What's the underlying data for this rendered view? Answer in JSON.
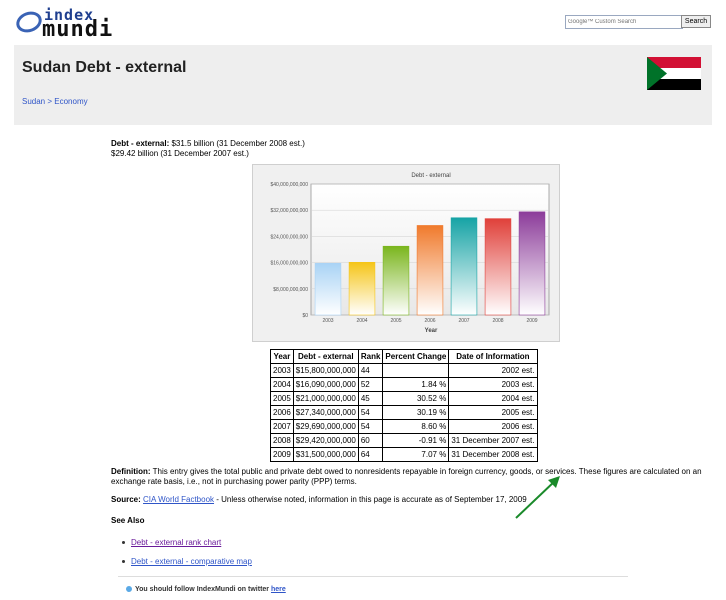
{
  "logo": {
    "line1": "index",
    "line2": "mundi"
  },
  "search": {
    "placeholder": "Google™ Custom Search",
    "button_label": "Search"
  },
  "page": {
    "title": "Sudan Debt - external"
  },
  "breadcrumb": {
    "country": "Sudan",
    "separator": " > ",
    "section": "Economy"
  },
  "facts": {
    "label": "Debt - external:",
    "line1_value": " $31.5 billion (31 December 2008 est.)",
    "line2": "$29.42 billion (31 December 2007 est.)"
  },
  "chart_data": {
    "type": "bar",
    "title": "Debt - external",
    "xlabel": "Year",
    "categories": [
      "2003",
      "2004",
      "2005",
      "2006",
      "2007",
      "2008",
      "2009"
    ],
    "values": [
      15800000000,
      16090000000,
      21000000000,
      27340000000,
      29690000000,
      29420000000,
      31500000000
    ],
    "ylim": [
      0,
      40000000000
    ],
    "yticks": [
      "$0",
      "$8,000,000,000",
      "$16,000,000,000",
      "$24,000,000,000",
      "$32,000,000,000",
      "$40,000,000,000"
    ],
    "colors": [
      "#a9d3f5",
      "#f5c518",
      "#7ab51d",
      "#f07a2c",
      "#16a3a5",
      "#e0403a",
      "#8c3c9a"
    ],
    "grid": true
  },
  "table": {
    "headers": [
      "Year",
      "Debt - external",
      "Rank",
      "Percent Change",
      "Date of Information"
    ],
    "rows": [
      [
        "2003",
        "$15,800,000,000",
        "44",
        "",
        "2002 est."
      ],
      [
        "2004",
        "$16,090,000,000",
        "52",
        "1.84 %",
        "2003 est."
      ],
      [
        "2005",
        "$21,000,000,000",
        "45",
        "30.52 %",
        "2004 est."
      ],
      [
        "2006",
        "$27,340,000,000",
        "54",
        "30.19 %",
        "2005 est."
      ],
      [
        "2007",
        "$29,690,000,000",
        "54",
        "8.60 %",
        "2006 est."
      ],
      [
        "2008",
        "$29,420,000,000",
        "60",
        "-0.91 %",
        "31 December 2007 est."
      ],
      [
        "2009",
        "$31,500,000,000",
        "64",
        "7.07 %",
        "31 December 2008 est."
      ]
    ]
  },
  "definition": {
    "label": "Definition:",
    "text": " This entry gives the total public and private debt owed to nonresidents repayable in foreign currency, goods, or services. These figures are calculated on an exchange rate basis, i.e., not in purchasing power parity (PPP) terms."
  },
  "source": {
    "label": "Source:",
    "link": "CIA World Factbook",
    "text": " - Unless otherwise noted, information in this page is accurate as of September 17, 2009"
  },
  "see_also": {
    "heading": "See Also",
    "links": [
      "Debt - external rank chart",
      "Debt - external - comparative map"
    ]
  },
  "twitter": {
    "text": "You should follow IndexMundi on twitter ",
    "link": "here"
  },
  "colors": {
    "banner_bg": "#eeeeee",
    "link": "#2f55c8",
    "visited": "#6a1b9a",
    "arrow": "#1a8a2a"
  }
}
